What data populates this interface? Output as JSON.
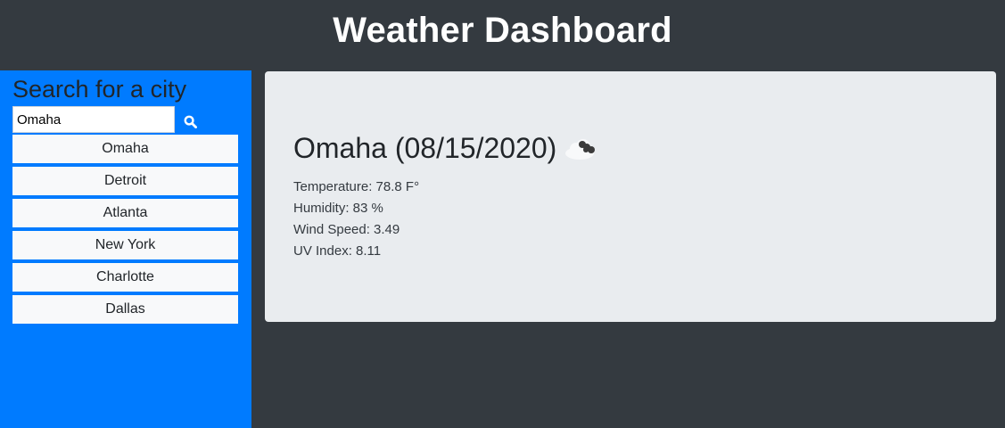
{
  "header": {
    "title": "Weather Dashboard"
  },
  "sidebar": {
    "heading": "Search for a city",
    "search": {
      "value": "Omaha",
      "icon": "search-icon"
    },
    "cities": [
      "Omaha",
      "Detroit",
      "Atlanta",
      "New York",
      "Charlotte",
      "Dallas"
    ]
  },
  "current": {
    "title": "Omaha (08/15/2020)",
    "icon": "cloud-icon",
    "temperature": "Temperature: 78.8 F°",
    "humidity": "Humidity: 83 %",
    "wind": "Wind Speed: 3.49",
    "uv": "UV Index: 8.11"
  },
  "colors": {
    "header_bg": "#343a40",
    "sidebar_bg": "#007bff",
    "card_bg": "#e9ecef",
    "city_btn_bg": "#f8f9fa"
  }
}
